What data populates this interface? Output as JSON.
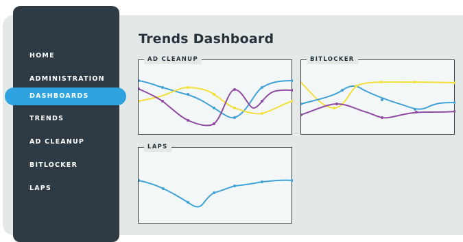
{
  "page": {
    "title": "Trends Dashboard"
  },
  "sidebar": {
    "items": [
      {
        "label": "HOME",
        "active": false
      },
      {
        "label": "ADMINISTRATION",
        "active": false
      },
      {
        "label": "DASHBOARDS",
        "active": true
      },
      {
        "label": "TRENDS",
        "active": false
      },
      {
        "label": "AD CLEANUP",
        "active": false
      },
      {
        "label": "BITLOCKER",
        "active": false
      },
      {
        "label": "LAPS",
        "active": false
      }
    ]
  },
  "colors": {
    "blue": "#3fa2d6",
    "yellow": "#f2df3a",
    "purple": "#8e4aa0"
  },
  "panels": [
    {
      "label": "AD CLEANUP"
    },
    {
      "label": "BITLOCKER"
    },
    {
      "label": "LAPS"
    }
  ]
}
